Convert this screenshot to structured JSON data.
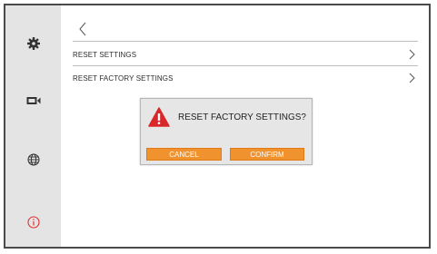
{
  "sidebar": {
    "items": [
      {
        "icon": "gear-icon",
        "active": false
      },
      {
        "icon": "camera-icon",
        "active": false
      },
      {
        "icon": "globe-icon",
        "active": false
      },
      {
        "icon": "info-icon",
        "active": true
      }
    ]
  },
  "main": {
    "rows": [
      {
        "label": "RESET SETTINGS"
      },
      {
        "label": "RESET FACTORY SETTINGS"
      }
    ]
  },
  "dialog": {
    "message": "RESET FACTORY SETTINGS?",
    "cancel_label": "CANCEL",
    "confirm_label": "CONFIRM"
  },
  "colors": {
    "accent": "#f0922d",
    "warning": "#d9262b",
    "info_active": "#e0302f",
    "sidebar_bg": "#e4e4e4"
  }
}
